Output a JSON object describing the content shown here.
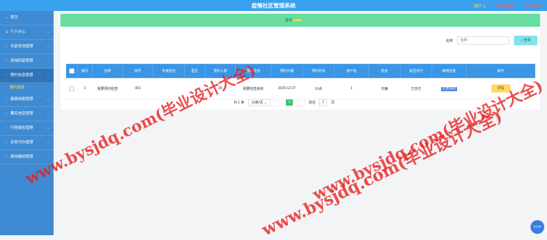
{
  "app": {
    "title": "疫情社区管理系统"
  },
  "topbar": {
    "user": "用户 1",
    "link1": "退出到前台",
    "link2": "退出登录"
  },
  "sidebar": {
    "items": [
      {
        "label": "首页",
        "icon": "home-icon"
      },
      {
        "label": "个人中心",
        "icon": "user-icon"
      },
      {
        "label": "专家咨询管理",
        "icon": "folder-icon"
      },
      {
        "label": "咨询回复管理",
        "icon": "folder-icon"
      },
      {
        "label": "预约信息管理",
        "icon": "folder-icon"
      },
      {
        "label": "健康档案管理",
        "icon": "folder-icon"
      },
      {
        "label": "报名信息管理",
        "icon": "folder-icon"
      },
      {
        "label": "行程报告管理",
        "icon": "folder-icon"
      },
      {
        "label": "业务代办管理",
        "icon": "folder-icon"
      },
      {
        "label": "费用缴纳管理",
        "icon": "folder-icon"
      }
    ],
    "sub_item": "预约信息"
  },
  "breadcrumb": {
    "label": "首页"
  },
  "search": {
    "label": "名称",
    "placeholder": "名称",
    "button": "查询"
  },
  "table": {
    "headers": [
      "索引",
      "名称",
      "账号",
      "专家姓名",
      "医生",
      "预约人数",
      "预约内容",
      "预约日期",
      "预约时间",
      "用户名",
      "姓名",
      "是否支付",
      "审核回复",
      "操作"
    ],
    "rows": [
      [
        "1",
        "我要预约检查",
        "001",
        "",
        "",
        "20",
        "我要检查身体",
        "2020-12-27",
        "10点",
        "1",
        "刘静",
        "已支付",
        "同意预约",
        "详情"
      ]
    ]
  },
  "pager": {
    "total": "共 1 条",
    "page_size": "10条/页",
    "current": "1",
    "goto": "前往",
    "goto_value": "1",
    "page_unit": "页"
  },
  "watermark": {
    "text1": "www.bysjdq.com(毕业设计大全)",
    "text2": "www.bysjdq.com(毕业设计大全)",
    "text3": "www.bysjdq.com(毕业设计大全)"
  },
  "clock": {
    "text": "24:05"
  }
}
